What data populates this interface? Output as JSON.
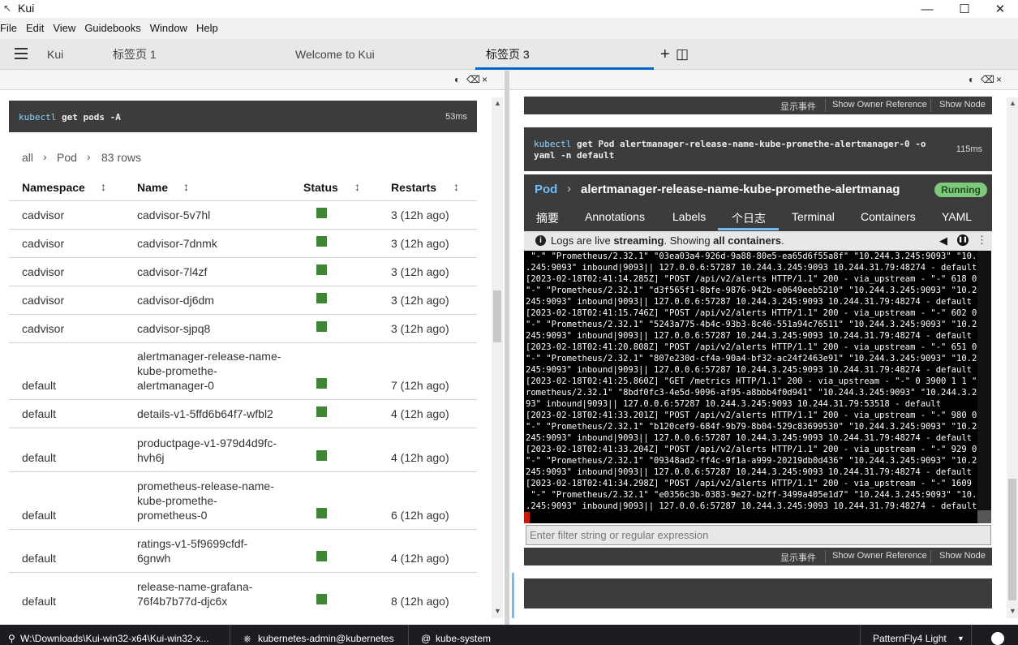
{
  "window": {
    "title": "Kui",
    "minimize": "—",
    "maximize": "☐",
    "close": "✕"
  },
  "menu": [
    "File",
    "Edit",
    "View",
    "Guidebooks",
    "Window",
    "Help"
  ],
  "tabs": {
    "app": "Kui",
    "tab1": "标签页 1",
    "tab2": "Welcome to Kui",
    "tab3": "标签页 3",
    "add": "+",
    "split": "◫"
  },
  "left": {
    "command": {
      "prefix": "kubectl",
      "args": "get pods -A",
      "duration": "53ms"
    },
    "breadcrumb": {
      "all": "all",
      "sep": "›",
      "kind": "Pod",
      "sep2": "›",
      "count": "83 rows"
    },
    "headers": {
      "namespace": "Namespace",
      "name": "Name",
      "status": "Status",
      "restarts": "Restarts",
      "sort": "↕"
    },
    "rows": [
      {
        "ns": "cadvisor",
        "name": "cadvisor-5v7hl",
        "restarts": "3 (12h ago)"
      },
      {
        "ns": "cadvisor",
        "name": "cadvisor-7dnmk",
        "restarts": "3 (12h ago)"
      },
      {
        "ns": "cadvisor",
        "name": "cadvisor-7l4zf",
        "restarts": "3 (12h ago)"
      },
      {
        "ns": "cadvisor",
        "name": "cadvisor-dj6dm",
        "restarts": "3 (12h ago)"
      },
      {
        "ns": "cadvisor",
        "name": "cadvisor-sjpq8",
        "restarts": "3 (12h ago)"
      },
      {
        "ns": "default",
        "name": "alertmanager-release-name-\nkube-promethe-\nalertmanager-0",
        "restarts": "7 (12h ago)"
      },
      {
        "ns": "default",
        "name": "details-v1-5ffd6b64f7-wfbl2",
        "restarts": "4 (12h ago)"
      },
      {
        "ns": "default",
        "name": "productpage-v1-979d4d9fc-\nhvh6j",
        "restarts": "4 (12h ago)"
      },
      {
        "ns": "default",
        "name": "prometheus-release-name-\nkube-promethe-\nprometheus-0",
        "restarts": "6 (12h ago)"
      },
      {
        "ns": "default",
        "name": "ratings-v1-5f9699cfdf-\n6gnwh",
        "restarts": "4 (12h ago)"
      },
      {
        "ns": "default",
        "name": "release-name-grafana-\n76f4b7b77d-djc6x",
        "restarts": "8 (12h ago)"
      }
    ]
  },
  "right": {
    "actions": {
      "events": "显示事件",
      "owner": "Show Owner Reference",
      "node": "Show Node"
    },
    "command": {
      "prefix": "kubectl",
      "line1": "get Pod alertmanager-release-name-kube-promethe-alertmanager-0 -o",
      "line2": "yaml -n default",
      "duration": "115ms"
    },
    "pod": {
      "kind": "Pod",
      "sep": "›",
      "name": "alertmanager-release-name-kube-promethe-alertmanag",
      "status": "Running"
    },
    "podtabs": [
      "摘要",
      "Annotations",
      "Labels",
      "个日志",
      "Terminal",
      "Containers",
      "YAML"
    ],
    "loginfo": {
      "a": "Logs are live ",
      "b": "streaming",
      "c": ". Showing ",
      "d": "all containers",
      "e": "."
    },
    "logs": [
      " \"-\" \"Prometheus/2.32.1\" \"03ea03a4-926d-9a88-80e5-ea65d6f55a8f\" \"10.244.3.245:9093\" \"10.244.3",
      ".245:9093\" inbound|9093|| 127.0.0.6:57287 10.244.3.245:9093 10.244.31.79:48274 - default",
      "[2023-02-18T02:41:14.285Z] \"POST /api/v2/alerts HTTP/1.1\" 200 - via_upstream - \"-\" 618 0 0 0",
      "\"-\" \"Prometheus/2.32.1\" \"d3f565f1-8bfe-9876-942b-e0649eeb5210\" \"10.244.3.245:9093\" \"10.244.3.",
      "245:9093\" inbound|9093|| 127.0.0.6:57287 10.244.3.245:9093 10.244.31.79:48274 - default",
      "[2023-02-18T02:41:15.746Z] \"POST /api/v2/alerts HTTP/1.1\" 200 - via_upstream - \"-\" 602 0 0 0",
      "\"-\" \"Prometheus/2.32.1\" \"5243a775-4b4c-93b3-8c46-551a94c76511\" \"10.244.3.245:9093\" \"10.244.3.",
      "245:9093\" inbound|9093|| 127.0.0.6:57287 10.244.3.245:9093 10.244.31.79:48274 - default",
      "[2023-02-18T02:41:20.808Z] \"POST /api/v2/alerts HTTP/1.1\" 200 - via_upstream - \"-\" 651 0 0 0",
      "\"-\" \"Prometheus/2.32.1\" \"807e230d-cf4a-90a4-bf32-ac24f2463e91\" \"10.244.3.245:9093\" \"10.244.3.",
      "245:9093\" inbound|9093|| 127.0.0.6:57287 10.244.3.245:9093 10.244.31.79:48274 - default",
      "[2023-02-18T02:41:25.860Z] \"GET /metrics HTTP/1.1\" 200 - via_upstream - \"-\" 0 3900 1 1 \"-\" \"P",
      "rometheus/2.32.1\" \"8bdf0fc3-4e5d-9096-af95-a8bbb4f0d941\" \"10.244.3.245:9093\" \"10.244.3.245:90",
      "93\" inbound|9093|| 127.0.0.6:57287 10.244.3.245:9093 10.244.31.79:53518 - default",
      "[2023-02-18T02:41:33.201Z] \"POST /api/v2/alerts HTTP/1.1\" 200 - via_upstream - \"-\" 980 0 0 0",
      "\"-\" \"Prometheus/2.32.1\" \"b120cef9-684f-9b79-8b04-529c83699530\" \"10.244.3.245:9093\" \"10.244.3.",
      "245:9093\" inbound|9093|| 127.0.0.6:57287 10.244.3.245:9093 10.244.31.79:48274 - default",
      "[2023-02-18T02:41:33.204Z] \"POST /api/v2/alerts HTTP/1.1\" 200 - via_upstream - \"-\" 929 0 1 0",
      "\"-\" \"Prometheus/2.32.1\" \"09348ad2-ff4c-9f1a-a999-20219db0d436\" \"10.244.3.245:9093\" \"10.244.3.",
      "245:9093\" inbound|9093|| 127.0.0.6:57287 10.244.3.245:9093 10.244.31.79:48274 - default",
      "[2023-02-18T02:41:34.298Z] \"POST /api/v2/alerts HTTP/1.1\" 200 - via_upstream - \"-\" 1609 0 1 0",
      " \"-\" \"Prometheus/2.32.1\" \"e0356c3b-0383-9e27-b2ff-3499a405e1d7\" \"10.244.3.245:9093\" \"10.244.3",
      ".245:9093\" inbound|9093|| 127.0.0.6:57287 10.244.3.245:9093 10.244.31.79:48274 - default"
    ],
    "filter_placeholder": "Enter filter string or regular expression"
  },
  "statusbar": {
    "path": "W:\\Downloads\\Kui-win32-x64\\Kui-win32-x...",
    "context": "kubernetes-admin@kubernetes",
    "namespace": "kube-system",
    "theme": "PatternFly4 Light"
  },
  "colors": {
    "status_green": "#3e8635",
    "accent": "#0066cc",
    "running_badge": "#7ec97e"
  }
}
